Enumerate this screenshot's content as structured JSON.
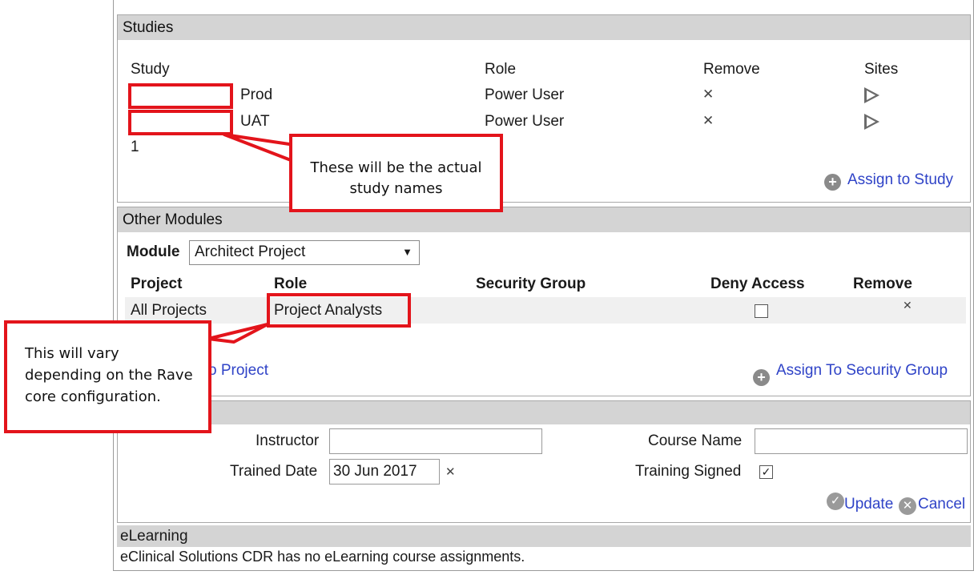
{
  "studies": {
    "header": "Studies",
    "columns": {
      "study": "Study",
      "role": "Role",
      "remove": "Remove",
      "sites": "Sites"
    },
    "rows": [
      {
        "env": "Prod",
        "role": "Power User"
      },
      {
        "env": "UAT",
        "role": "Power User"
      }
    ],
    "pager": "1",
    "assign_link": "Assign to Study"
  },
  "other_modules": {
    "header": "Other Modules",
    "module_label": "Module",
    "module_value": "Architect Project",
    "columns": {
      "project": "Project",
      "role": "Role",
      "security_group": "Security Group",
      "deny_access": "Deny Access",
      "remove": "Remove"
    },
    "row": {
      "project": "All Projects",
      "role": "Project Analysts"
    },
    "assign_project_link": "o Project",
    "assign_security_link": "Assign To Security Group"
  },
  "training": {
    "instructor_label": "Instructor",
    "instructor_value": "",
    "course_label": "Course Name",
    "course_value": "",
    "trained_date_label": "Trained Date",
    "trained_date_value": "30 Jun 2017",
    "training_signed_label": "Training Signed",
    "training_signed": true,
    "update_label": "Update",
    "cancel_label": "Cancel"
  },
  "elearning": {
    "header": "eLearning",
    "message": "eClinical Solutions CDR has no eLearning course assignments."
  },
  "annotations": {
    "study_names_line1": "These will be the actual",
    "study_names_line2": "study names",
    "rave_line1": "This will vary",
    "rave_line2": "depending on the Rave",
    "rave_line3": "core configuration."
  },
  "colors": {
    "annotation_red": "#e3141b",
    "link_blue": "#2f43c7",
    "header_grey": "#d4d4d4"
  }
}
